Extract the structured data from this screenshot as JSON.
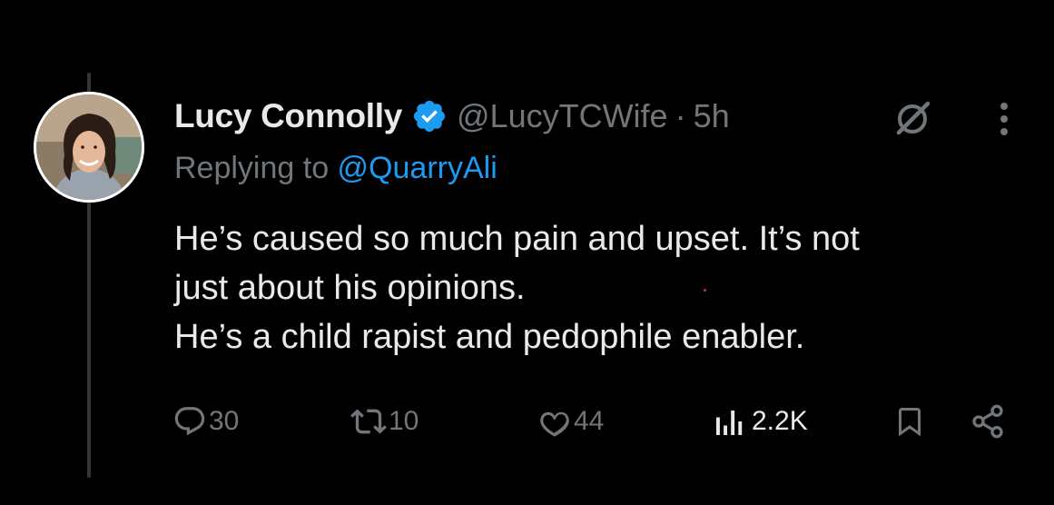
{
  "tweet": {
    "author_name": "Lucy Connolly",
    "handle": "@LucyTCWife",
    "separator": "·",
    "time": "5h",
    "replying_prefix": "Replying to ",
    "replying_to": "@QuarryAli",
    "text_lines": [
      "He’s caused so much pain and upset. It’s not",
      "just about his opinions.",
      "He’s a child rapist and pedophile enabler."
    ]
  },
  "actions": {
    "replies": "30",
    "reposts": "10",
    "likes": "44",
    "views": "2.2K"
  },
  "icons": {
    "verified": "verified-badge-icon",
    "grok": "grok-icon",
    "more": "more-icon",
    "reply": "reply-icon",
    "repost": "repost-icon",
    "like": "heart-icon",
    "views": "analytics-icon",
    "bookmark": "bookmark-icon",
    "share": "share-icon"
  },
  "colors": {
    "background": "#000000",
    "text_primary": "#e7e9ea",
    "text_secondary": "#71767b",
    "accent": "#1d9bf0",
    "thread_line": "#333639"
  }
}
